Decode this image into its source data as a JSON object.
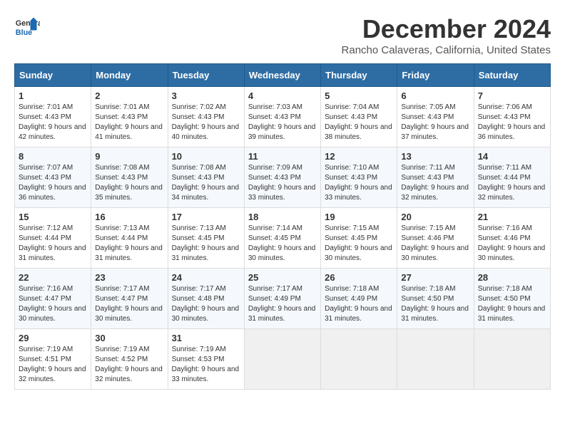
{
  "logo": {
    "text_general": "General",
    "text_blue": "Blue"
  },
  "header": {
    "title": "December 2024",
    "subtitle": "Rancho Calaveras, California, United States"
  },
  "weekdays": [
    "Sunday",
    "Monday",
    "Tuesday",
    "Wednesday",
    "Thursday",
    "Friday",
    "Saturday"
  ],
  "weeks": [
    [
      {
        "day": "1",
        "sunrise": "7:01 AM",
        "sunset": "4:43 PM",
        "daylight": "9 hours and 42 minutes."
      },
      {
        "day": "2",
        "sunrise": "7:01 AM",
        "sunset": "4:43 PM",
        "daylight": "9 hours and 41 minutes."
      },
      {
        "day": "3",
        "sunrise": "7:02 AM",
        "sunset": "4:43 PM",
        "daylight": "9 hours and 40 minutes."
      },
      {
        "day": "4",
        "sunrise": "7:03 AM",
        "sunset": "4:43 PM",
        "daylight": "9 hours and 39 minutes."
      },
      {
        "day": "5",
        "sunrise": "7:04 AM",
        "sunset": "4:43 PM",
        "daylight": "9 hours and 38 minutes."
      },
      {
        "day": "6",
        "sunrise": "7:05 AM",
        "sunset": "4:43 PM",
        "daylight": "9 hours and 37 minutes."
      },
      {
        "day": "7",
        "sunrise": "7:06 AM",
        "sunset": "4:43 PM",
        "daylight": "9 hours and 36 minutes."
      }
    ],
    [
      {
        "day": "8",
        "sunrise": "7:07 AM",
        "sunset": "4:43 PM",
        "daylight": "9 hours and 36 minutes."
      },
      {
        "day": "9",
        "sunrise": "7:08 AM",
        "sunset": "4:43 PM",
        "daylight": "9 hours and 35 minutes."
      },
      {
        "day": "10",
        "sunrise": "7:08 AM",
        "sunset": "4:43 PM",
        "daylight": "9 hours and 34 minutes."
      },
      {
        "day": "11",
        "sunrise": "7:09 AM",
        "sunset": "4:43 PM",
        "daylight": "9 hours and 33 minutes."
      },
      {
        "day": "12",
        "sunrise": "7:10 AM",
        "sunset": "4:43 PM",
        "daylight": "9 hours and 33 minutes."
      },
      {
        "day": "13",
        "sunrise": "7:11 AM",
        "sunset": "4:43 PM",
        "daylight": "9 hours and 32 minutes."
      },
      {
        "day": "14",
        "sunrise": "7:11 AM",
        "sunset": "4:44 PM",
        "daylight": "9 hours and 32 minutes."
      }
    ],
    [
      {
        "day": "15",
        "sunrise": "7:12 AM",
        "sunset": "4:44 PM",
        "daylight": "9 hours and 31 minutes."
      },
      {
        "day": "16",
        "sunrise": "7:13 AM",
        "sunset": "4:44 PM",
        "daylight": "9 hours and 31 minutes."
      },
      {
        "day": "17",
        "sunrise": "7:13 AM",
        "sunset": "4:45 PM",
        "daylight": "9 hours and 31 minutes."
      },
      {
        "day": "18",
        "sunrise": "7:14 AM",
        "sunset": "4:45 PM",
        "daylight": "9 hours and 30 minutes."
      },
      {
        "day": "19",
        "sunrise": "7:15 AM",
        "sunset": "4:45 PM",
        "daylight": "9 hours and 30 minutes."
      },
      {
        "day": "20",
        "sunrise": "7:15 AM",
        "sunset": "4:46 PM",
        "daylight": "9 hours and 30 minutes."
      },
      {
        "day": "21",
        "sunrise": "7:16 AM",
        "sunset": "4:46 PM",
        "daylight": "9 hours and 30 minutes."
      }
    ],
    [
      {
        "day": "22",
        "sunrise": "7:16 AM",
        "sunset": "4:47 PM",
        "daylight": "9 hours and 30 minutes."
      },
      {
        "day": "23",
        "sunrise": "7:17 AM",
        "sunset": "4:47 PM",
        "daylight": "9 hours and 30 minutes."
      },
      {
        "day": "24",
        "sunrise": "7:17 AM",
        "sunset": "4:48 PM",
        "daylight": "9 hours and 30 minutes."
      },
      {
        "day": "25",
        "sunrise": "7:17 AM",
        "sunset": "4:49 PM",
        "daylight": "9 hours and 31 minutes."
      },
      {
        "day": "26",
        "sunrise": "7:18 AM",
        "sunset": "4:49 PM",
        "daylight": "9 hours and 31 minutes."
      },
      {
        "day": "27",
        "sunrise": "7:18 AM",
        "sunset": "4:50 PM",
        "daylight": "9 hours and 31 minutes."
      },
      {
        "day": "28",
        "sunrise": "7:18 AM",
        "sunset": "4:50 PM",
        "daylight": "9 hours and 31 minutes."
      }
    ],
    [
      {
        "day": "29",
        "sunrise": "7:19 AM",
        "sunset": "4:51 PM",
        "daylight": "9 hours and 32 minutes."
      },
      {
        "day": "30",
        "sunrise": "7:19 AM",
        "sunset": "4:52 PM",
        "daylight": "9 hours and 32 minutes."
      },
      {
        "day": "31",
        "sunrise": "7:19 AM",
        "sunset": "4:53 PM",
        "daylight": "9 hours and 33 minutes."
      },
      null,
      null,
      null,
      null
    ]
  ]
}
